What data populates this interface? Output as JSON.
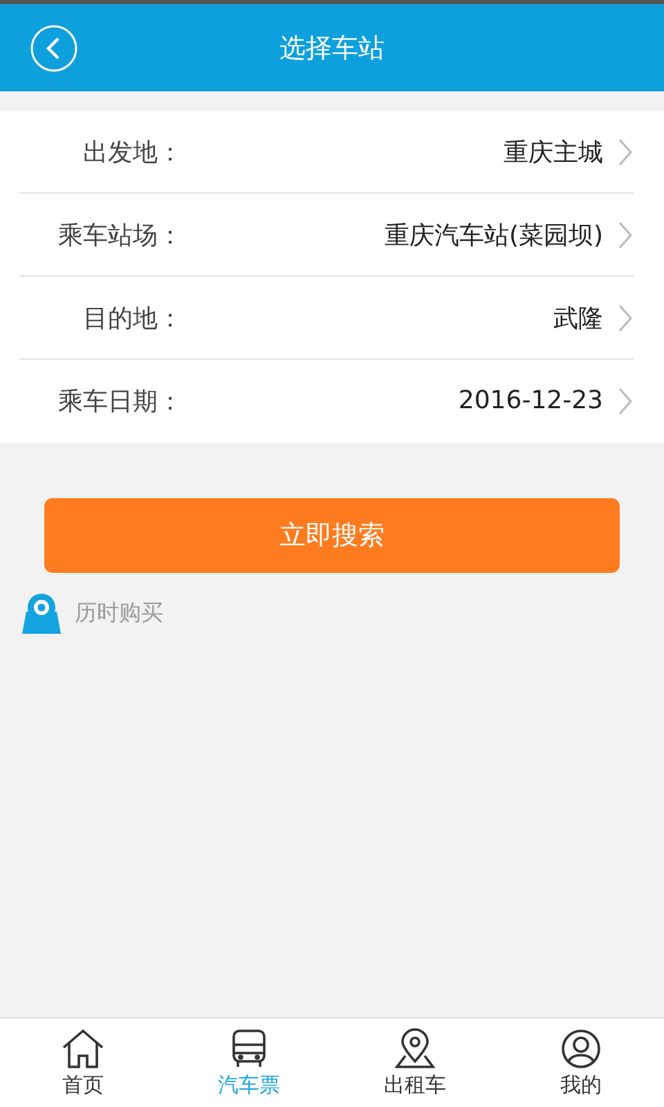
{
  "header": {
    "title": "选择车站"
  },
  "fields": [
    {
      "label": "出发地：",
      "value": "重庆主城"
    },
    {
      "label": "乘车站场：",
      "value": "重庆汽车站(菜园坝)"
    },
    {
      "label": "目的地：",
      "value": "武隆"
    },
    {
      "label": "乘车日期：",
      "value": "2016-12-23"
    }
  ],
  "search_button": "立即搜索",
  "history_link": "历时购买",
  "tabs": [
    {
      "label": "首页",
      "kind": "home",
      "selected": false
    },
    {
      "label": "汽车票",
      "kind": "bus",
      "selected": true
    },
    {
      "label": "出租车",
      "kind": "taxi",
      "selected": false
    },
    {
      "label": "我的",
      "kind": "profile",
      "selected": false
    }
  ]
}
